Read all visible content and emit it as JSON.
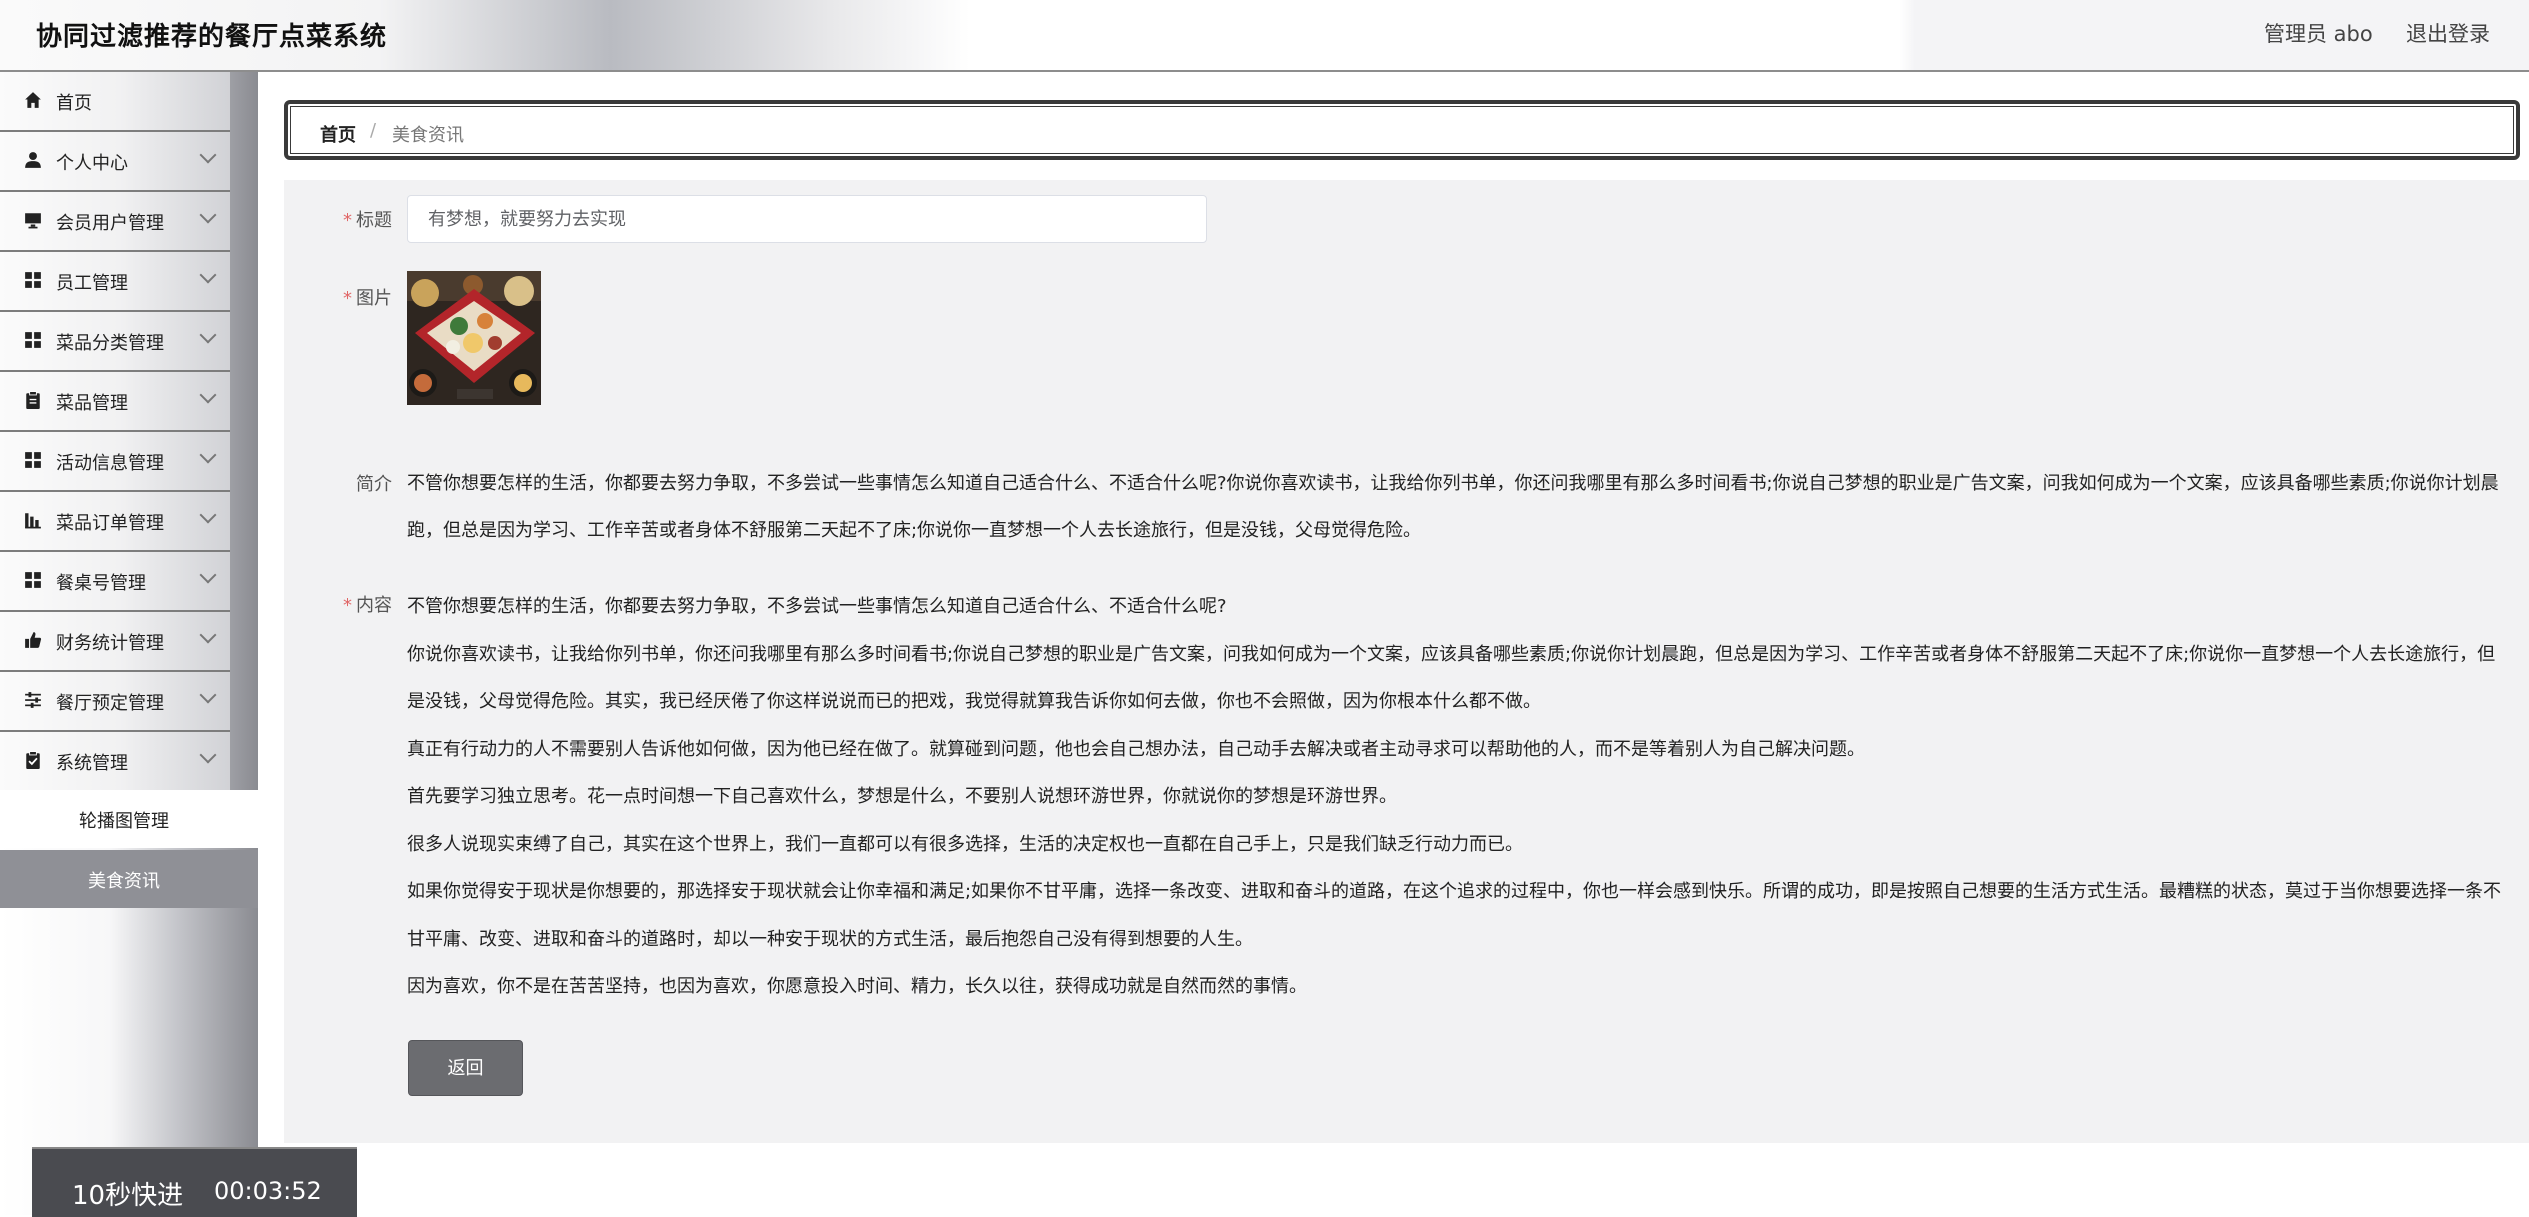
{
  "header": {
    "app_title": "协同过滤推荐的餐厅点菜系统",
    "user_info": "管理员 abo",
    "logout_label": "退出登录"
  },
  "sidebar": {
    "items": [
      {
        "label": "首页",
        "icon": "home-icon"
      },
      {
        "label": "个人中心",
        "icon": "user-icon"
      },
      {
        "label": "会员用户管理",
        "icon": "monitor-icon"
      },
      {
        "label": "员工管理",
        "icon": "grid-icon"
      },
      {
        "label": "菜品分类管理",
        "icon": "grid-icon"
      },
      {
        "label": "菜品管理",
        "icon": "clipboard-icon"
      },
      {
        "label": "活动信息管理",
        "icon": "grid-icon"
      },
      {
        "label": "菜品订单管理",
        "icon": "bar-chart-icon"
      },
      {
        "label": "餐桌号管理",
        "icon": "grid-icon"
      },
      {
        "label": "财务统计管理",
        "icon": "thumbs-up-icon"
      },
      {
        "label": "餐厅预定管理",
        "icon": "sliders-icon"
      },
      {
        "label": "系统管理",
        "icon": "checklist-icon"
      }
    ],
    "submenu": [
      {
        "label": "轮播图管理"
      },
      {
        "label": "美食资讯"
      }
    ]
  },
  "breadcrumb": {
    "home": "首页",
    "separator": "/",
    "current": "美食资讯"
  },
  "form": {
    "title_label": "标题",
    "title_placeholder": "有梦想，就要努力去实现",
    "image_label": "图片",
    "intro_label": "简介",
    "intro_text": "不管你想要怎样的生活，你都要去努力争取，不多尝试一些事情怎么知道自己适合什么、不适合什么呢?你说你喜欢读书，让我给你列书单，你还问我哪里有那么多时间看书;你说自己梦想的职业是广告文案，问我如何成为一个文案，应该具备哪些素质;你说你计划晨跑，但总是因为学习、工作辛苦或者身体不舒服第二天起不了床;你说你一直梦想一个人去长途旅行，但是没钱，父母觉得危险。",
    "content_label": "内容",
    "content_paragraphs": [
      "不管你想要怎样的生活，你都要去努力争取，不多尝试一些事情怎么知道自己适合什么、不适合什么呢?",
      "你说你喜欢读书，让我给你列书单，你还问我哪里有那么多时间看书;你说自己梦想的职业是广告文案，问我如何成为一个文案，应该具备哪些素质;你说你计划晨跑，但总是因为学习、工作辛苦或者身体不舒服第二天起不了床;你说你一直梦想一个人去长途旅行，但是没钱，父母觉得危险。其实，我已经厌倦了你这样说说而已的把戏，我觉得就算我告诉你如何去做，你也不会照做，因为你根本什么都不做。",
      "真正有行动力的人不需要别人告诉他如何做，因为他已经在做了。就算碰到问题，他也会自己想办法，自己动手去解决或者主动寻求可以帮助他的人，而不是等着别人为自己解决问题。",
      "首先要学习独立思考。花一点时间想一下自己喜欢什么，梦想是什么，不要别人说想环游世界，你就说你的梦想是环游世界。",
      "很多人说现实束缚了自己，其实在这个世界上，我们一直都可以有很多选择，生活的决定权也一直都在自己手上，只是我们缺乏行动力而已。",
      "如果你觉得安于现状是你想要的，那选择安于现状就会让你幸福和满足;如果你不甘平庸，选择一条改变、进取和奋斗的道路，在这个追求的过程中，你也一样会感到快乐。所谓的成功，即是按照自己想要的生活方式生活。最糟糕的状态，莫过于当你想要选择一条不甘平庸、改变、进取和奋斗的道路时，却以一种安于现状的方式生活，最后抱怨自己没有得到想要的人生。",
      "因为喜欢，你不是在苦苦坚持，也因为喜欢，你愿意投入时间、精力，长久以往，获得成功就是自然而然的事情。"
    ],
    "required_mark": "*",
    "back_button": "返回"
  },
  "overlay": {
    "fast_forward_label": "10秒快进",
    "timecode": "00:03:52"
  }
}
